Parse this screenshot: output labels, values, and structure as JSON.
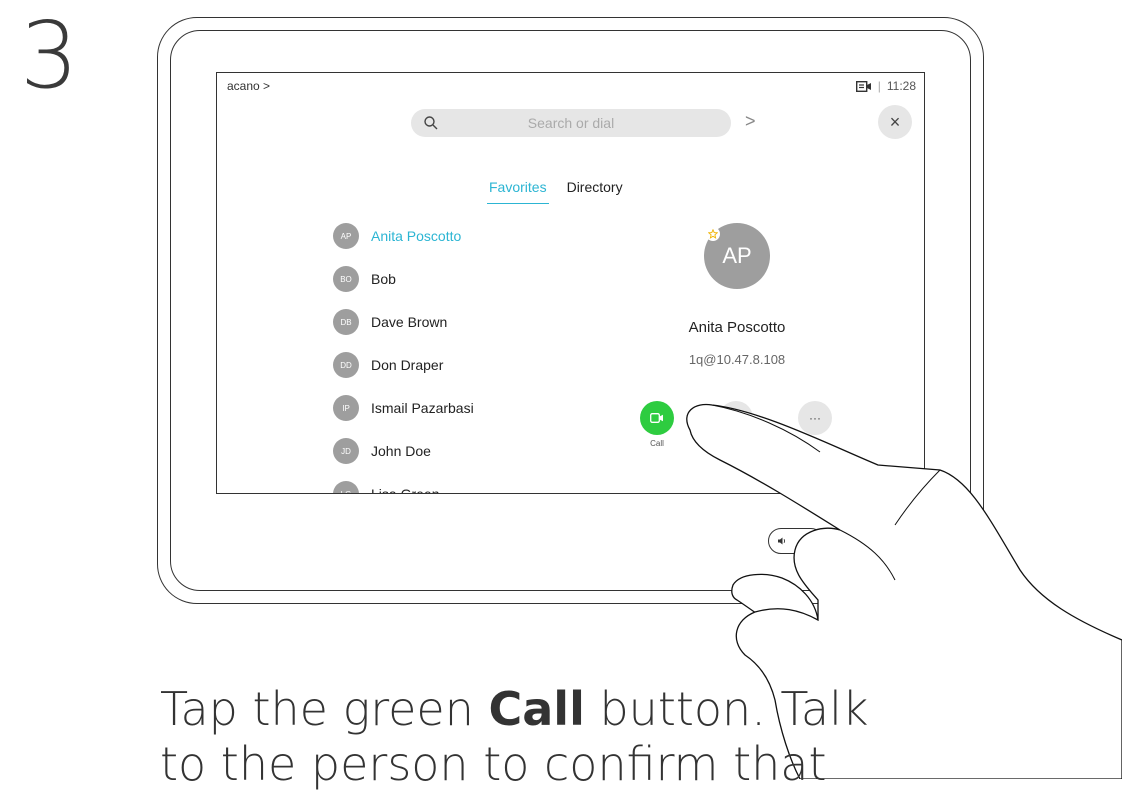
{
  "step": "3",
  "topbar": {
    "left": "acano >",
    "time": "11:28",
    "sep": "|"
  },
  "search": {
    "placeholder": "Search or dial",
    "chevron": ">"
  },
  "close_symbol": "×",
  "tabs": [
    {
      "label": "Favorites",
      "active": true
    },
    {
      "label": "Directory",
      "active": false
    }
  ],
  "contacts": [
    {
      "initials": "AP",
      "name": "Anita Poscotto",
      "selected": true
    },
    {
      "initials": "BO",
      "name": "Bob",
      "selected": false
    },
    {
      "initials": "DB",
      "name": "Dave Brown",
      "selected": false
    },
    {
      "initials": "DD",
      "name": "Don Draper",
      "selected": false
    },
    {
      "initials": "IP",
      "name": "Ismail Pazarbasi",
      "selected": false
    },
    {
      "initials": "JD",
      "name": "John Doe",
      "selected": false
    },
    {
      "initials": "LG",
      "name": "Lisa Green",
      "selected": false
    }
  ],
  "detail": {
    "initials": "AP",
    "name": "Anita Poscotto",
    "address": "1q@10.47.8.108"
  },
  "actions": [
    {
      "label": "Call"
    },
    {
      "label": ""
    },
    {
      "label": "More",
      "symbol": "···"
    }
  ],
  "instruction": {
    "pre": "Tap the green ",
    "bold": "Call",
    "post": " button. Talk",
    "line2": "to the person to confirm that"
  },
  "colors": {
    "accent": "#2cb5d3",
    "call_green": "#2ecc40",
    "avatar_grey": "#9e9e9e"
  }
}
